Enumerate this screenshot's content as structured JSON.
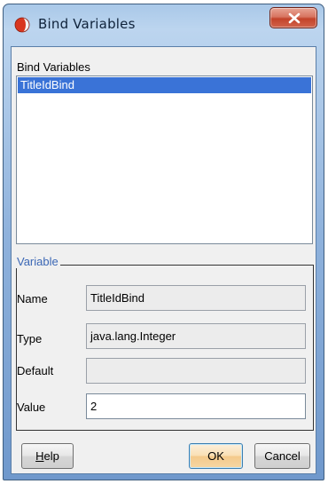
{
  "window": {
    "title": "Bind Variables",
    "close_label": "x"
  },
  "list": {
    "label": "Bind Variables",
    "items": [
      {
        "label": "TitleIdBind",
        "selected": true
      }
    ]
  },
  "variable_group": {
    "title": "Variable",
    "fields": {
      "name": {
        "label": "Name",
        "value": "TitleIdBind",
        "editable": false
      },
      "type": {
        "label": "Type",
        "value": "java.lang.Integer",
        "editable": false
      },
      "default": {
        "label": "Default",
        "value": "",
        "editable": false
      },
      "value": {
        "label": "Value",
        "value": "2",
        "editable": true
      }
    }
  },
  "buttons": {
    "help_mnemonic": "H",
    "help_rest": "elp",
    "ok": "OK",
    "cancel": "Cancel"
  },
  "colors": {
    "selection": "#3a73d7",
    "group_title": "#3b67b5",
    "close_button": "#c3432a"
  },
  "icons": {
    "app": "oracle-app-icon",
    "close": "close-icon"
  }
}
